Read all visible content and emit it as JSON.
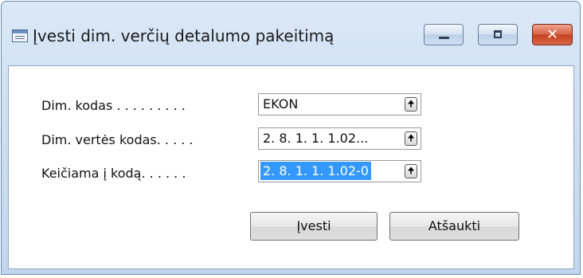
{
  "window": {
    "title": "Įvesti dim. verčių detalumo pakeitimą",
    "icon": "form-window-icon",
    "controls": [
      "minimize-icon",
      "maximize-icon",
      "close-icon"
    ],
    "close_glyph": "✕"
  },
  "form": {
    "fields": [
      {
        "label": "Dim. kodas . . . . . . . . .",
        "value": "EKON",
        "selected": false,
        "lookup": "arrow-up-icon"
      },
      {
        "label": "Dim. vertės kodas. . . . .",
        "value": "2. 8. 1. 1. 1.02...",
        "selected": false,
        "lookup": "arrow-up-icon"
      },
      {
        "label": "Keičiama į kodą. . . . . .",
        "value": "2. 8. 1. 1. 1.02-0",
        "selected": true,
        "lookup": "arrow-up-icon"
      }
    ],
    "lookup_glyph": "🠉"
  },
  "buttons": {
    "ok_label": "Įvesti",
    "cancel_label": "Atšaukti"
  },
  "colors": {
    "selection": "#3399ff",
    "close_button": "#c4401f",
    "title_bar": "#c9dcf1"
  }
}
